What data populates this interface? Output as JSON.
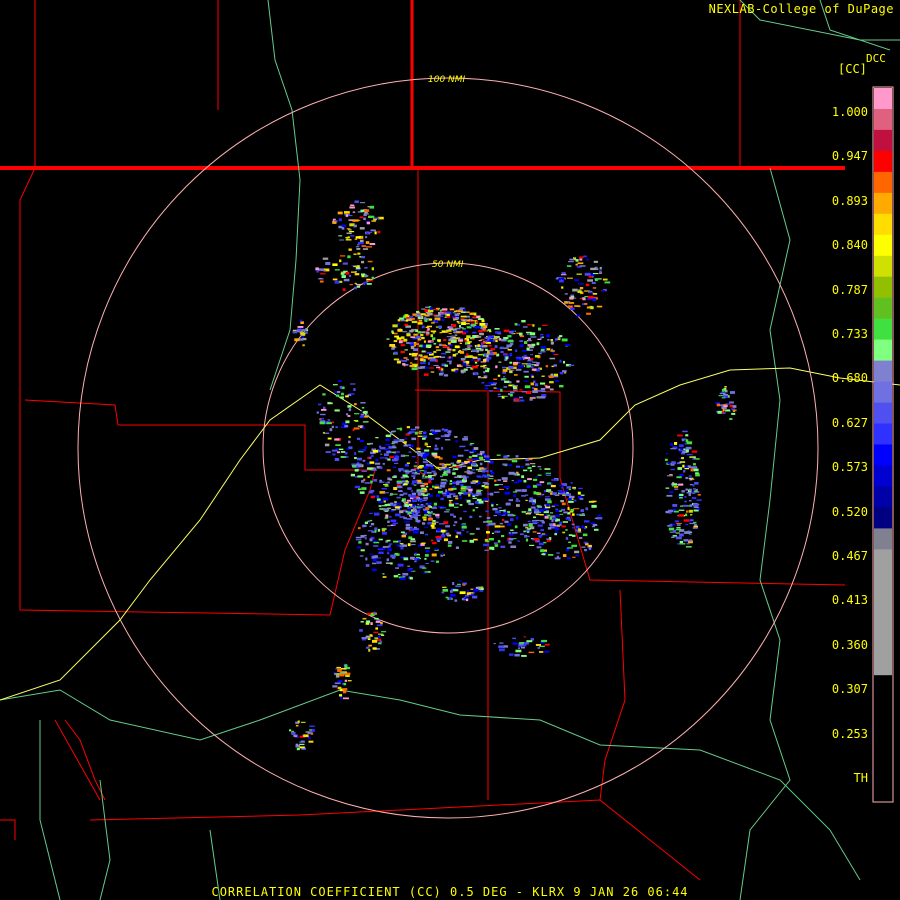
{
  "header": {
    "credit": "NEXLAB-College of DuPage",
    "unit": "[CC]",
    "dcc": "DCC"
  },
  "footer": {
    "product": "CORRELATION COEFFICIENT (CC) 0.5 DEG - KLRX 9 JAN 26 06:44"
  },
  "range_rings": [
    {
      "label": "100 NMI"
    },
    {
      "label": "50 NMI"
    }
  ],
  "legend": {
    "ticks": [
      "1.000",
      "0.947",
      "0.893",
      "0.840",
      "0.787",
      "0.733",
      "0.680",
      "0.627",
      "0.573",
      "0.520",
      "0.467",
      "0.413",
      "0.360",
      "0.307",
      "0.253",
      "TH"
    ],
    "colors": [
      "#ff99cc",
      "#e0607f",
      "#c01040",
      "#ff0000",
      "#ff6600",
      "#ffaa00",
      "#ffdd00",
      "#ffff00",
      "#d0e000",
      "#90c000",
      "#60c020",
      "#40e040",
      "#80ff80",
      "#8080d0",
      "#7070e0",
      "#5050f0",
      "#3030ff",
      "#0000ff",
      "#0000d0",
      "#0000a8",
      "#000080",
      "#808090",
      "#a0a0a0",
      "#000000"
    ]
  },
  "colors": {
    "boundary": "#ff0000",
    "ring": "#ffb0b0",
    "highway": "#ffff66",
    "river": "#66cc88",
    "text": "#ffff00"
  }
}
